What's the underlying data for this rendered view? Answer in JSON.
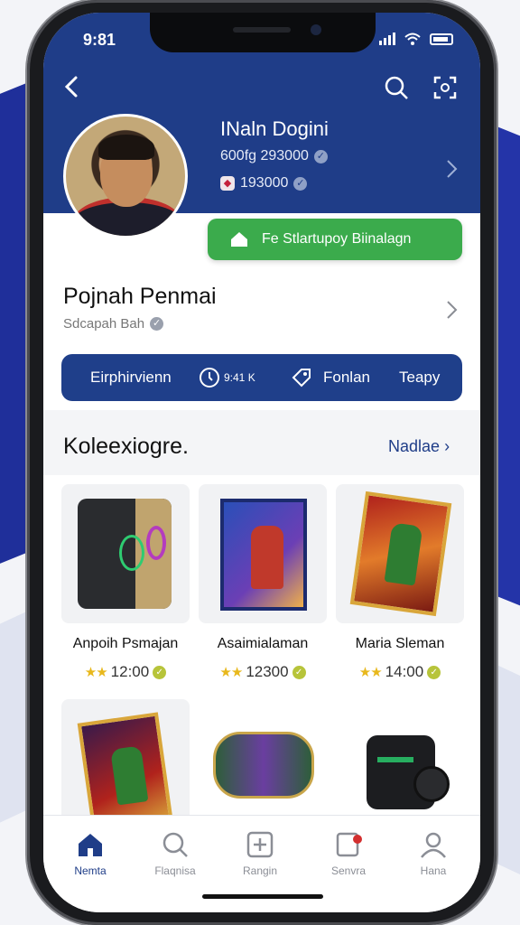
{
  "status": {
    "time": "9:81"
  },
  "profile": {
    "name": "INaln Dogini",
    "stat1": "600fg 293000",
    "stat2": "193000",
    "green_button": "Fe   Stlartupoy Biinalagn"
  },
  "player": {
    "title": "Pojnah Penmai",
    "subtitle": "Sdcapah Bah"
  },
  "info_bar": {
    "label1": "Eirphirvienn",
    "label2": "9:41 K",
    "label3": "Fonlan",
    "label4": "Teapy"
  },
  "collection": {
    "title": "Koleexiogre.",
    "link": "Nadlae",
    "items": [
      {
        "name": "Anpoih Psmajan",
        "price": "12:00",
        "icon": "speaker"
      },
      {
        "name": "Asaimialaman",
        "price": "12300",
        "icon": "game-box"
      },
      {
        "name": "Maria Sleman",
        "price": "14:00",
        "icon": "trading-card"
      },
      {
        "name": "",
        "price": "",
        "icon": "trading-card"
      },
      {
        "name": "",
        "price": "",
        "icon": "rolled-mat"
      },
      {
        "name": "",
        "price": "",
        "icon": "bag"
      }
    ]
  },
  "tabs": [
    {
      "label": "Nemta",
      "icon": "home-icon",
      "active": true
    },
    {
      "label": "Flaqnisa",
      "icon": "search-icon",
      "active": false
    },
    {
      "label": "Rangin",
      "icon": "add-icon",
      "active": false
    },
    {
      "label": "Senvra",
      "icon": "notification-icon",
      "active": false
    },
    {
      "label": "Hana",
      "icon": "user-icon",
      "active": false
    }
  ],
  "colors": {
    "header_blue": "#1f3d88",
    "accent_green": "#3bab4c",
    "star_gold": "#e8b81c"
  }
}
